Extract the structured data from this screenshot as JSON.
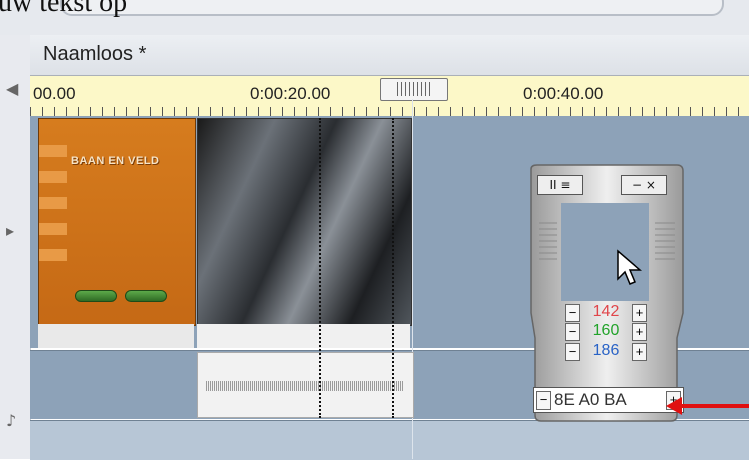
{
  "caption": {
    "text": "uw tekst op"
  },
  "tab": {
    "title": "Naamloos *"
  },
  "ruler": {
    "label_start": "00.00",
    "label_mid": "0:00:20.00",
    "label_end": "0:00:40.00"
  },
  "title_clip": {
    "text": "BAAN EN VELD"
  },
  "color_widget": {
    "red_value": "142",
    "green_value": "160",
    "blue_value": "186",
    "hex_value": "8E A0 BA",
    "minus_symbol": "−",
    "plus_symbol": "+",
    "btn_panels": "II ≡",
    "btn_window": "− ×"
  },
  "colors": {
    "red": "#e0454a",
    "green": "#22a32a",
    "blue": "#2a63c6",
    "track": "#8da2b8",
    "arrow": "#e01010"
  }
}
